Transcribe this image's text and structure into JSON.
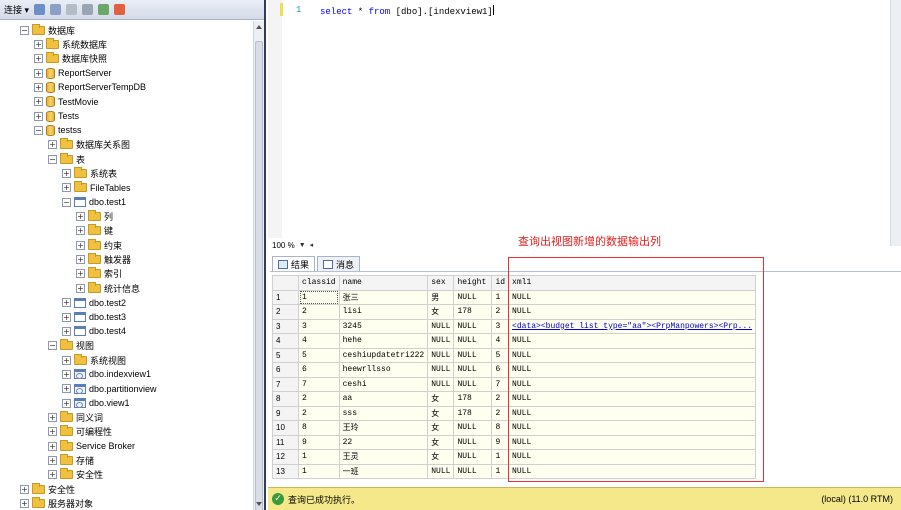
{
  "explorer": {
    "toolbar": {
      "connect_label": "连接 ▾"
    },
    "tree": [
      {
        "label": "数据库",
        "indent": 0,
        "icon": "folder",
        "expander": "−"
      },
      {
        "label": "系统数据库",
        "indent": 1,
        "icon": "folder",
        "expander": "+"
      },
      {
        "label": "数据库快照",
        "indent": 1,
        "icon": "folder",
        "expander": "+"
      },
      {
        "label": "ReportServer",
        "indent": 1,
        "icon": "db",
        "expander": "+"
      },
      {
        "label": "ReportServerTempDB",
        "indent": 1,
        "icon": "db",
        "expander": "+"
      },
      {
        "label": "TestMovie",
        "indent": 1,
        "icon": "db",
        "expander": "+"
      },
      {
        "label": "Tests",
        "indent": 1,
        "icon": "db",
        "expander": "+"
      },
      {
        "label": "testss",
        "indent": 1,
        "icon": "db",
        "expander": "−"
      },
      {
        "label": "数据库关系图",
        "indent": 2,
        "icon": "folder",
        "expander": "+"
      },
      {
        "label": "表",
        "indent": 2,
        "icon": "folder",
        "expander": "−"
      },
      {
        "label": "系统表",
        "indent": 3,
        "icon": "folder",
        "expander": "+"
      },
      {
        "label": "FileTables",
        "indent": 3,
        "icon": "folder",
        "expander": "+"
      },
      {
        "label": "dbo.test1",
        "indent": 3,
        "icon": "table",
        "expander": "−"
      },
      {
        "label": "列",
        "indent": 4,
        "icon": "folder",
        "expander": "+"
      },
      {
        "label": "键",
        "indent": 4,
        "icon": "folder",
        "expander": "+"
      },
      {
        "label": "约束",
        "indent": 4,
        "icon": "folder",
        "expander": "+"
      },
      {
        "label": "触发器",
        "indent": 4,
        "icon": "folder",
        "expander": "+"
      },
      {
        "label": "索引",
        "indent": 4,
        "icon": "folder",
        "expander": "+"
      },
      {
        "label": "统计信息",
        "indent": 4,
        "icon": "folder",
        "expander": "+"
      },
      {
        "label": "dbo.test2",
        "indent": 3,
        "icon": "table",
        "expander": "+"
      },
      {
        "label": "dbo.test3",
        "indent": 3,
        "icon": "table",
        "expander": "+"
      },
      {
        "label": "dbo.test4",
        "indent": 3,
        "icon": "table",
        "expander": "+"
      },
      {
        "label": "视图",
        "indent": 2,
        "icon": "folder",
        "expander": "−"
      },
      {
        "label": "系统视图",
        "indent": 3,
        "icon": "folder",
        "expander": "+"
      },
      {
        "label": "dbo.indexview1",
        "indent": 3,
        "icon": "view",
        "expander": "+"
      },
      {
        "label": "dbo.partitionview",
        "indent": 3,
        "icon": "view",
        "expander": "+"
      },
      {
        "label": "dbo.view1",
        "indent": 3,
        "icon": "view",
        "expander": "+"
      },
      {
        "label": "同义词",
        "indent": 2,
        "icon": "folder",
        "expander": "+"
      },
      {
        "label": "可编程性",
        "indent": 2,
        "icon": "folder",
        "expander": "+"
      },
      {
        "label": "Service Broker",
        "indent": 2,
        "icon": "folder",
        "expander": "+"
      },
      {
        "label": "存储",
        "indent": 2,
        "icon": "folder",
        "expander": "+"
      },
      {
        "label": "安全性",
        "indent": 2,
        "icon": "folder",
        "expander": "+"
      },
      {
        "label": "安全性",
        "indent": 0,
        "icon": "folder",
        "expander": "+"
      },
      {
        "label": "服务器对象",
        "indent": 0,
        "icon": "folder",
        "expander": "+"
      }
    ]
  },
  "editor": {
    "line_number": "1",
    "query": {
      "kw_select": "select",
      "star": " * ",
      "kw_from": "from",
      "object": " [dbo].[indexview1]"
    },
    "zoom": "100 %"
  },
  "annotation": "查询出视图新增的数据输出列",
  "results": {
    "tabs": [
      "结果",
      "消息"
    ],
    "columns": [
      "classid",
      "name",
      "sex",
      "height",
      "id",
      "xml1"
    ],
    "rows": [
      [
        "1",
        "1",
        "张三",
        "男",
        "NULL",
        "1",
        "NULL"
      ],
      [
        "2",
        "2",
        "lisi",
        "女",
        "178",
        "2",
        "NULL"
      ],
      [
        "3",
        "3",
        "3245",
        "NULL",
        "NULL",
        "3",
        "<data><budget list type=\"aa\"><PrpManpowers><Prp..."
      ],
      [
        "4",
        "4",
        "hehe",
        "NULL",
        "NULL",
        "4",
        "NULL"
      ],
      [
        "5",
        "5",
        "ceshiupdatetri222",
        "NULL",
        "NULL",
        "5",
        "NULL"
      ],
      [
        "6",
        "6",
        "heewrllsso",
        "NULL",
        "NULL",
        "6",
        "NULL"
      ],
      [
        "7",
        "7",
        "ceshi",
        "NULL",
        "NULL",
        "7",
        "NULL"
      ],
      [
        "8",
        "2",
        "aa",
        "女",
        "178",
        "2",
        "NULL"
      ],
      [
        "9",
        "2",
        "sss",
        "女",
        "178",
        "2",
        "NULL"
      ],
      [
        "10",
        "8",
        "王玲",
        "女",
        "NULL",
        "8",
        "NULL"
      ],
      [
        "11",
        "9",
        "22",
        "女",
        "NULL",
        "9",
        "NULL"
      ],
      [
        "12",
        "1",
        "王灵",
        "女",
        "NULL",
        "1",
        "NULL"
      ],
      [
        "13",
        "1",
        "一班",
        "NULL",
        "NULL",
        "1",
        "NULL"
      ]
    ]
  },
  "status": {
    "message": "查询已成功执行。",
    "server": "(local) (11.0 RTM)"
  },
  "colors": {
    "accent_red": "#e02020",
    "status_bar": "#f5e88a",
    "keyword_blue": "#0000ff",
    "line_number": "#2b91af"
  }
}
